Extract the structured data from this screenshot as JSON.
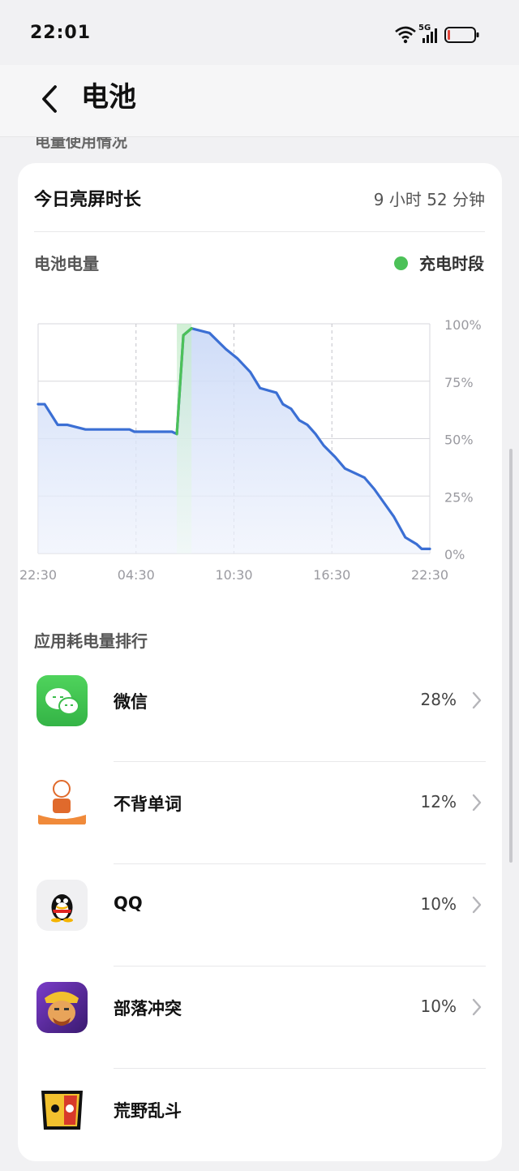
{
  "status_bar": {
    "time": "22:01",
    "network": "5G"
  },
  "header": {
    "title": "电池"
  },
  "section_peek": "电量使用情况",
  "screen_time": {
    "label": "今日亮屏时长",
    "value": "9 小时 52 分钟"
  },
  "battery_chart_label": "电池电量",
  "legend": {
    "charging_label": "充电时段",
    "charging_color": "#4cc158"
  },
  "chart_data": {
    "type": "area",
    "x_tick_labels": [
      "22:30",
      "04:30",
      "10:30",
      "16:30",
      "22:30"
    ],
    "y_tick_labels": [
      "100%",
      "75%",
      "50%",
      "25%",
      "0%"
    ],
    "ylim": [
      0,
      100
    ],
    "x_unit": "hours since 22:30",
    "xlim": [
      0,
      24
    ],
    "line_color": "#3b6fd4",
    "charging_color": "#4cc158",
    "points": [
      [
        0,
        65
      ],
      [
        0.4,
        65
      ],
      [
        1.2,
        56
      ],
      [
        1.8,
        56
      ],
      [
        2.9,
        54
      ],
      [
        5.6,
        54
      ],
      [
        5.9,
        53
      ],
      [
        8.2,
        53
      ],
      [
        8.5,
        52
      ],
      [
        8.9,
        95
      ],
      [
        9.4,
        98
      ],
      [
        10.5,
        96
      ],
      [
        11.5,
        89
      ],
      [
        12.2,
        85
      ],
      [
        13.0,
        79
      ],
      [
        13.6,
        72
      ],
      [
        14.6,
        70
      ],
      [
        15.0,
        65
      ],
      [
        15.5,
        63
      ],
      [
        16.0,
        58
      ],
      [
        16.5,
        56
      ],
      [
        17.0,
        52
      ],
      [
        17.5,
        47
      ],
      [
        18.2,
        42
      ],
      [
        18.8,
        37
      ],
      [
        19.4,
        35
      ],
      [
        20.0,
        33
      ],
      [
        20.6,
        28
      ],
      [
        21.2,
        22
      ],
      [
        21.8,
        16
      ],
      [
        22.5,
        7
      ],
      [
        23.2,
        4
      ],
      [
        23.5,
        2
      ],
      [
        24.0,
        2
      ]
    ],
    "charging_segment": [
      [
        8.5,
        52
      ],
      [
        8.9,
        95
      ],
      [
        9.4,
        98
      ]
    ],
    "grid": true
  },
  "ranking_title": "应用耗电量排行",
  "apps": [
    {
      "name": "微信",
      "percent": "28%",
      "icon": "wechat-icon"
    },
    {
      "name": "不背单词",
      "percent": "12%",
      "icon": "bubei-icon"
    },
    {
      "name": "QQ",
      "percent": "10%",
      "icon": "qq-icon"
    },
    {
      "name": "部落冲突",
      "percent": "10%",
      "icon": "coc-icon"
    },
    {
      "name": "荒野乱斗",
      "percent": "",
      "icon": "brawlstars-icon"
    }
  ],
  "colors": {
    "accent_blue": "#3b6fd4",
    "charging_green": "#4cc158",
    "page_bg": "#f1f1f3"
  }
}
